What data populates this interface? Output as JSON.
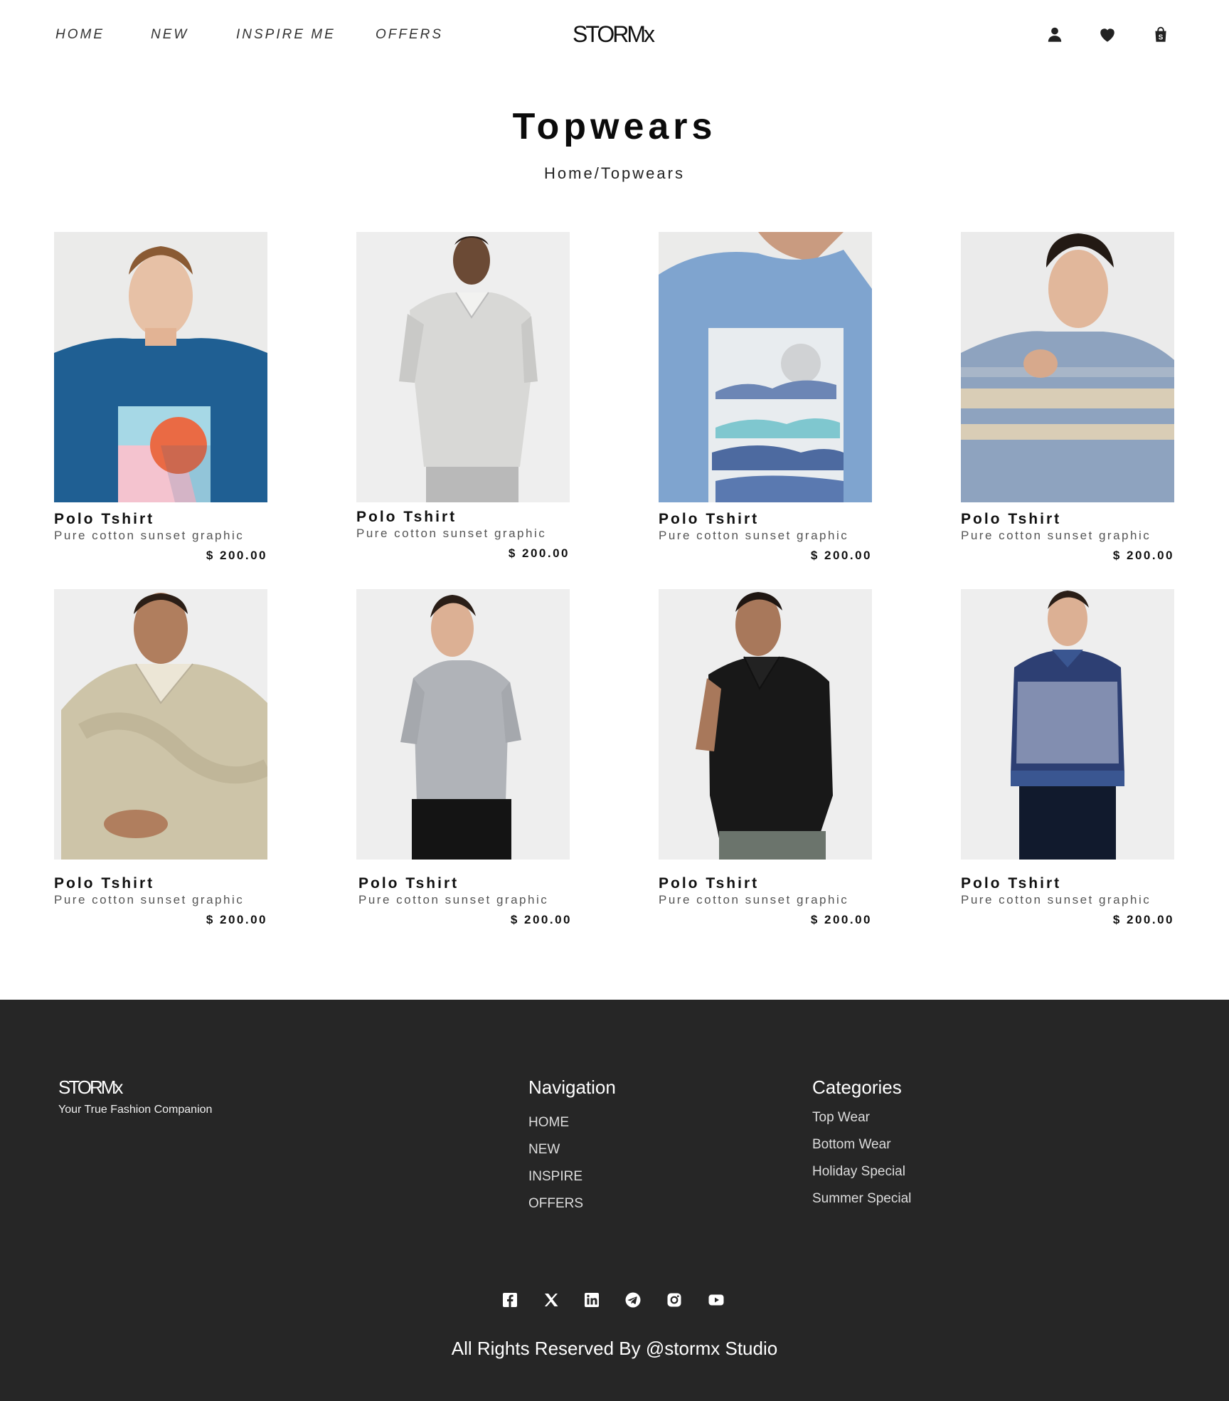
{
  "header": {
    "nav": [
      "HOME",
      "NEW",
      "INSPIRE ME",
      "OFFERS"
    ],
    "logo": "STORMx",
    "icons": [
      "user-icon",
      "heart-icon",
      "shopping-bag-icon"
    ]
  },
  "page": {
    "title": "Topwears",
    "breadcrumb": "Home/Topwears"
  },
  "products": [
    {
      "name": "Polo Tshirt",
      "desc": "Pure cotton sunset graphic",
      "price": "$ 200.00",
      "image": "blue-graphic-tee"
    },
    {
      "name": "Polo Tshirt",
      "desc": "Pure cotton sunset graphic",
      "price": "$ 200.00",
      "image": "grey-polo"
    },
    {
      "name": "Polo Tshirt",
      "desc": "Pure cotton sunset graphic",
      "price": "$ 200.00",
      "image": "light-blue-back-print-tee"
    },
    {
      "name": "Polo Tshirt",
      "desc": "Pure cotton sunset graphic",
      "price": "$ 200.00",
      "image": "striped-tee"
    },
    {
      "name": "Polo Tshirt",
      "desc": "Pure cotton sunset graphic",
      "price": "$ 200.00",
      "image": "beige-pattern-polo"
    },
    {
      "name": "Polo Tshirt",
      "desc": "Pure cotton sunset graphic",
      "price": "$ 200.00",
      "image": "grey-striped-tee"
    },
    {
      "name": "Polo Tshirt",
      "desc": "Pure cotton sunset graphic",
      "price": "$ 200.00",
      "image": "black-polo"
    },
    {
      "name": "Polo Tshirt",
      "desc": "Pure cotton sunset graphic",
      "price": "$ 200.00",
      "image": "navy-knit-polo"
    }
  ],
  "footer": {
    "logo": "STORMx",
    "tagline": "Your True Fashion Companion",
    "navigation": {
      "heading": "Navigation",
      "links": [
        "HOME",
        "NEW",
        "INSPIRE",
        "OFFERS"
      ]
    },
    "categories": {
      "heading": "Categories",
      "links": [
        "Top Wear",
        "Bottom Wear",
        "Holiday Special",
        "Summer Special"
      ]
    },
    "social": [
      "facebook-icon",
      "x-icon",
      "linkedin-icon",
      "telegram-icon",
      "instagram-icon",
      "youtube-icon"
    ],
    "copyright": "All Rights Reserved By @stormx Studio"
  },
  "colors": {
    "footer_bg": "#262626",
    "card_bg": "#eeeeee",
    "text": "#111111"
  }
}
